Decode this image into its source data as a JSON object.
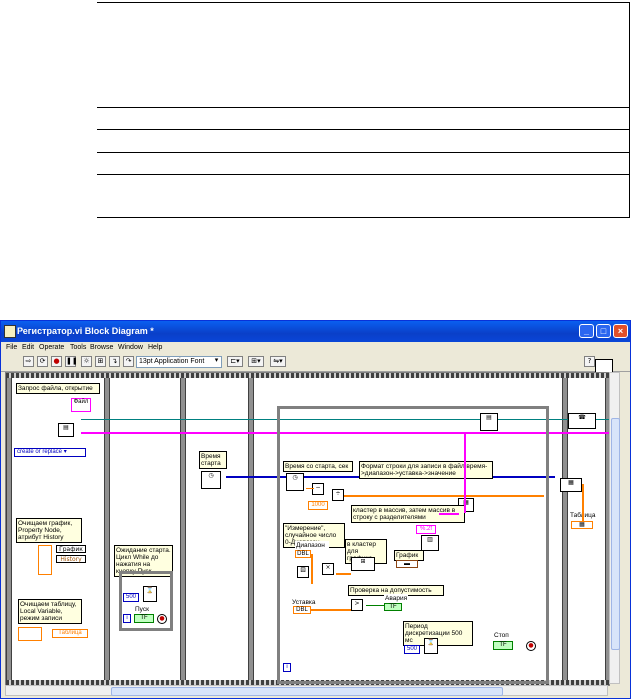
{
  "window": {
    "title": "Регистратор.vi Block Diagram *",
    "controls": {
      "minimize": "_",
      "maximize": "□",
      "close": "×"
    }
  },
  "menu": [
    "File",
    "Edit",
    "Operate",
    "Tools",
    "Browse",
    "Window",
    "Help"
  ],
  "toolbar": {
    "font": "13pt Application Font"
  },
  "diagram": {
    "frame1": {
      "comment_open": "Запрос файла, открытие",
      "file_ctrl": "Файл",
      "create_mode": "create or replace",
      "comment_clear_chart": "Очищаем график, Property Node, атрибут History",
      "chart_node": "График",
      "history": "History",
      "comment_clear_table": "Очищаем таблицу, Local Variable, режим записи",
      "table_local": "Таблица"
    },
    "frame2": {
      "comment_wait": "Ожидание старта. Цикл While до нажатия на кнопку Пуск",
      "ms_value": "500",
      "start_button": "Пуск",
      "loop_index": "i"
    },
    "frame3": {
      "comment_start_time": "Время старта"
    },
    "frame4": {
      "comment_since_start": "Время со старта, сек",
      "const_1000": "1000",
      "comment_format": "Формат строки для записи в файл время->диапазон->уставка->значение",
      "format_const": "%.2f",
      "comment_cluster": "кластер в массив, затем массив в строку с разделителями",
      "comment_random": "\"Измерение\", случайное число 0-Диапазон",
      "range_ctrl": "Диапазон",
      "to_cluster": "в кластер для графика",
      "chart_term": "График",
      "setpoint_ctrl": "Уставка",
      "comment_check": "Проверка на допустимость",
      "alarm_ind": "Авария",
      "comment_period": "Период дискретизации 500 мс",
      "wait_ms": "500",
      "stop_button": "Стоп",
      "loop_index": "i",
      "tab_char": "\\t"
    },
    "frame5": {
      "table_ind": "Таблица"
    }
  },
  "colors": {
    "accent": "#0a46d8",
    "string_wire": "#ff00ff",
    "numeric_wire": "#ff8000",
    "refnum_wire": "#008080",
    "bool_wire": "#008000"
  }
}
